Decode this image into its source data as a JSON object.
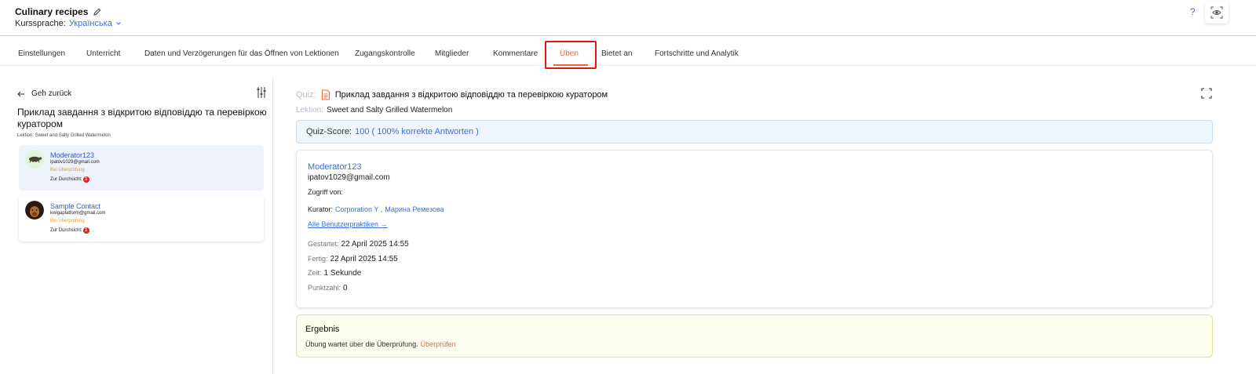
{
  "header": {
    "course_title": "Culinary recipes",
    "language_label": "Kurssprache:",
    "language_value": "Українська",
    "help": "?"
  },
  "tabs": [
    {
      "label": "Einstellungen"
    },
    {
      "label": "Unterricht"
    },
    {
      "label": "Daten und Verzögerungen für das Öffnen von Lektionen"
    },
    {
      "label": "Zugangskontrolle"
    },
    {
      "label": "Mitglieder"
    },
    {
      "label": "Kommentare"
    },
    {
      "label": "Üben",
      "active": true
    },
    {
      "label": "Bietet an"
    },
    {
      "label": "Fortschritte und Analytik"
    }
  ],
  "sidebar": {
    "back_label": "Geh zurück",
    "title": "Приклад завдання з відкритою відповіддю та перевіркою куратором",
    "lesson": "Lektion: Sweet and Salty Grilled Watermelon",
    "contacts": [
      {
        "name": "Moderator123",
        "email": "ipatov1029@gmail.com",
        "status": "Bei Überprüfung",
        "review_label": "Zur Durchsicht:",
        "review_count": "1"
      },
      {
        "name": "Sample Contact",
        "email": "kwigaplatform@gmail.com",
        "status": "Bei Überprüfung",
        "review_label": "Zur Durchsicht:",
        "review_count": "1"
      }
    ]
  },
  "main": {
    "quiz_label": "Quiz:",
    "quiz_title": "Приклад завдання з відкритою відповіддю та перевіркою куратором",
    "lesson_label": "Lektion:",
    "lesson_value": "Sweet and Salty Grilled Watermelon",
    "score_label": "Quiz-Score:",
    "score_value": "100 ( 100% korrekte Antworten )",
    "detail": {
      "name": "Moderator123",
      "email": "ipatov1029@gmail.com",
      "access_label": "Zugriff von:",
      "curator_label": "Kurator:",
      "curator_1": "Corporation Y ,",
      "curator_2": "Марина Ремезова",
      "all_practices": "Alle Benutzerpraktiken →",
      "started_label": "Gestartet:",
      "started_value": "22 April 2025 14:55",
      "finished_label": "Fertig:",
      "finished_value": "22 April 2025 14:55",
      "time_label": "Zeit:",
      "time_value": "1 Sekunde",
      "points_label": "Punktzahl:",
      "points_value": "0"
    },
    "result": {
      "title": "Ergebnis",
      "text": "Übung wartet über die Überprüfung.",
      "link": "Überprüfen"
    }
  },
  "colors": {
    "accent": "#e8693c",
    "link": "#3b6fd6",
    "highlight": "#e31414"
  }
}
